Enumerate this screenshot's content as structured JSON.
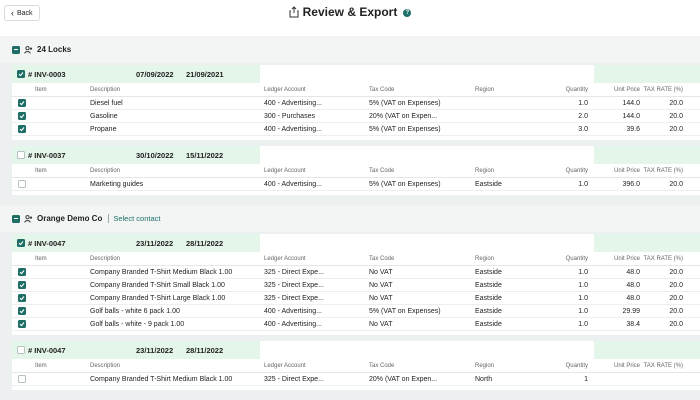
{
  "header": {
    "back_label": "Back",
    "title": "Review & Export",
    "help_glyph": "?"
  },
  "columns": {
    "item": "Item",
    "description": "Description",
    "ledger": "Ledger Account",
    "tax": "Tax Code",
    "region": "Region",
    "quantity": "Quantity",
    "unit_price": "Unit Price",
    "tax_rate": "TAX RATE (%)"
  },
  "groups": [
    {
      "name": "24 Locks",
      "select_contact": "",
      "invoices": [
        {
          "number": "# INV-0003",
          "date": "07/09/2022",
          "due": "21/09/2021",
          "checked": true,
          "rows": [
            {
              "checked": true,
              "item": "",
              "description": "Diesel fuel",
              "ledger": "400 - Advertising...",
              "tax": "5% (VAT on Expenses)",
              "region": "",
              "quantity": "1.0",
              "unit_price": "144.0",
              "tax_rate": "20.0"
            },
            {
              "checked": true,
              "item": "",
              "description": "Gasoline",
              "ledger": "300 - Purchases",
              "tax": "20% (VAT on Expen...",
              "region": "",
              "quantity": "2.0",
              "unit_price": "144.0",
              "tax_rate": "20.0"
            },
            {
              "checked": true,
              "item": "",
              "description": "Propane",
              "ledger": "400 - Advertising...",
              "tax": "5% (VAT on Expenses)",
              "region": "",
              "quantity": "3.0",
              "unit_price": "39.6",
              "tax_rate": "20.0"
            }
          ]
        },
        {
          "number": "# INV-0037",
          "date": "30/10/2022",
          "due": "15/11/2022",
          "checked": false,
          "rows": [
            {
              "checked": false,
              "item": "",
              "description": "Marketing guides",
              "ledger": "400 - Advertising...",
              "tax": "5% (VAT on Expenses)",
              "region": "Eastside",
              "quantity": "1.0",
              "unit_price": "396.0",
              "tax_rate": "20.0"
            }
          ]
        }
      ]
    },
    {
      "name": "Orange Demo Co",
      "select_contact": "Select contact",
      "invoices": [
        {
          "number": "# INV-0047",
          "date": "23/11/2022",
          "due": "28/11/2022",
          "checked": true,
          "rows": [
            {
              "checked": true,
              "item": "",
              "description": "Company Branded T-Shirt Medium Black 1.00",
              "ledger": "325 - Direct Expe...",
              "tax": "No VAT",
              "region": "Eastside",
              "quantity": "1.0",
              "unit_price": "48.0",
              "tax_rate": "20.0"
            },
            {
              "checked": true,
              "item": "",
              "description": "Company Branded T-Shirt Small Black 1.00",
              "ledger": "325 - Direct Expe...",
              "tax": "No VAT",
              "region": "Eastside",
              "quantity": "1.0",
              "unit_price": "48.0",
              "tax_rate": "20.0"
            },
            {
              "checked": true,
              "item": "",
              "description": "Company Branded T-Shirt Large Black 1.00",
              "ledger": "325 - Direct Expe...",
              "tax": "No VAT",
              "region": "Eastside",
              "quantity": "1.0",
              "unit_price": "48.0",
              "tax_rate": "20.0"
            },
            {
              "checked": true,
              "item": "",
              "description": "Golf balls - white 6 pack 1.00",
              "ledger": "400 - Advertising...",
              "tax": "5% (VAT on Expenses)",
              "region": "Eastside",
              "quantity": "1.0",
              "unit_price": "29.99",
              "tax_rate": "20.0"
            },
            {
              "checked": true,
              "item": "",
              "description": "Golf balls - white - 9 pack 1.00",
              "ledger": "400 - Advertising...",
              "tax": "No VAT",
              "region": "Eastside",
              "quantity": "1.0",
              "unit_price": "38.4",
              "tax_rate": "20.0"
            }
          ]
        },
        {
          "number": "# INV-0047",
          "date": "23/11/2022",
          "due": "28/11/2022",
          "checked": false,
          "rows": [
            {
              "checked": false,
              "item": "",
              "description": "Company Branded T-Shirt Medium Black 1.00",
              "ledger": "325 - Direct Expe...",
              "tax": "20% (VAT on Expen...",
              "region": "North",
              "quantity": "1",
              "unit_price": "",
              "tax_rate": ""
            }
          ]
        }
      ]
    }
  ],
  "colors": {
    "accent": "#1e6e66",
    "header_green": "#e4f5ea",
    "background": "#edf0f0"
  }
}
